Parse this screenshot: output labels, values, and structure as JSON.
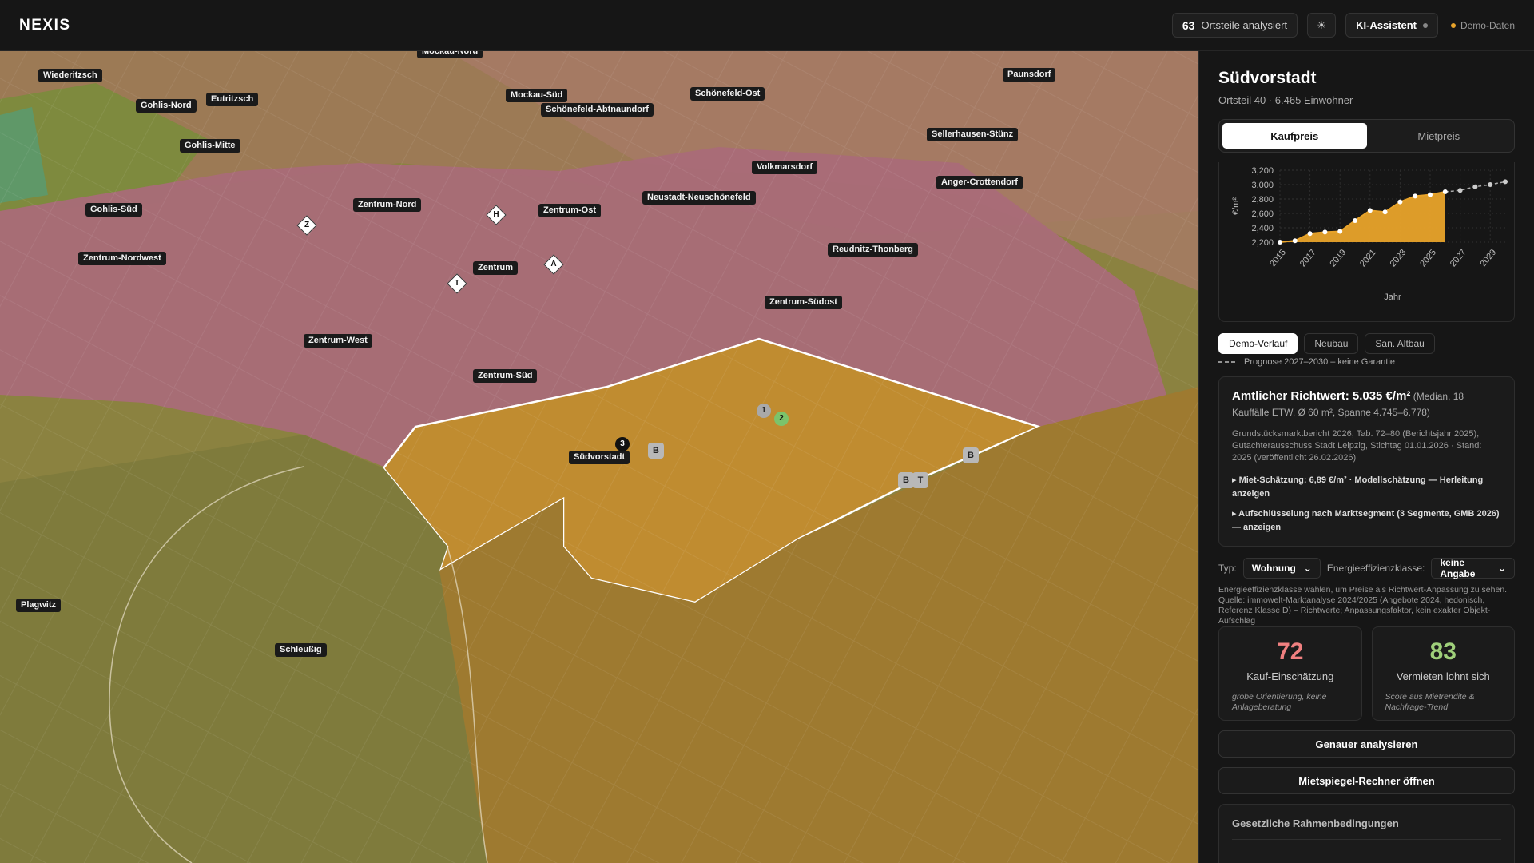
{
  "app": {
    "brand": "NEXIS"
  },
  "topbar": {
    "count": "63",
    "count_label": "Ortsteile analysiert",
    "theme_icon": "☀",
    "assistant_label": "KI-Assistent",
    "demo_label": "Demo-Daten",
    "assistant_dot_color": "#888888",
    "demo_dot_color": "#e8a32a"
  },
  "map": {
    "labels": [
      "Wiederitzsch",
      "Gohlis-Nord",
      "Eutritzsch",
      "Mockau-Nord",
      "Mockau-Süd",
      "Schönefeld-Abtnaundorf",
      "Schönefeld-Ost",
      "Paunsdorf",
      "Sellerhausen-Stünz",
      "Gohlis-Mitte",
      "Volkmarsdorf",
      "Anger-Crottendorf",
      "Gohlis-Süd",
      "Zentrum-Nord",
      "Zentrum-Ost",
      "Neustadt-Neuschönefeld",
      "Zentrum-Nordwest",
      "Reudnitz-Thonberg",
      "Zentrum",
      "Zentrum-Südost",
      "Zentrum-West",
      "Zentrum-Süd",
      "Südvorstadt",
      "Plagwitz",
      "Schleußig"
    ],
    "pois": [
      "Z",
      "H",
      "A",
      "T"
    ],
    "markers": [
      "B",
      "B",
      "B",
      "T",
      "1",
      "2",
      "3"
    ]
  },
  "panel": {
    "title": "Südvorstadt",
    "subtitle": "Ortsteil 40 · 6.465 Einwohner",
    "tabs": [
      "Kaufpreis",
      "Mietpreis"
    ],
    "series_chips": [
      "Demo-Verlauf",
      "Neubau",
      "San. Altbau"
    ],
    "forecast_note": "Prognose 2027–2030 – keine Garantie",
    "info": {
      "title": "Amtlicher Richtwert: 5.035 €/m²",
      "title_small": " (Median, 18 Kauffälle ETW, Ø 60 m², Spanne 4.745–6.778)",
      "source": "Grundstücksmarktbericht 2026, Tab. 72–80 (Berichtsjahr 2025), Gutachterausschuss Stadt Leipzig, Stichtag 01.01.2026 · Stand: 2025 (veröffentlicht 26.02.2026)",
      "link1": "▸ Miet-Schätzung: 6,89 €/m² · Modellschätzung — Herleitung anzeigen",
      "link2": "▸ Aufschlüsselung nach Marktsegment (3 Segmente, GMB 2026) — anzeigen"
    },
    "filters": {
      "type_label": "Typ:",
      "type_value": "Wohnung",
      "energy_label": "Energieeffizienzklasse:",
      "energy_value": "keine Angabe"
    },
    "hint": "Energieeffizienzklasse wählen, um Preise als Richtwert-Anpassung zu sehen. Quelle: immowelt-Marktanalyse 2024/2025 (Angebote 2024, hedonisch, Referenz Klasse D) – Richtwerte; Anpassungsfaktor, kein exakter Objekt-Aufschlag",
    "scores": [
      {
        "value": "72",
        "caption": "Kauf-Einschätzung",
        "note": "grobe Orientierung, keine Anlageberatung",
        "color": "#f08080"
      },
      {
        "value": "83",
        "caption": "Vermieten lohnt sich",
        "note": "Score aus Mietrendite & Nachfrage-Trend",
        "color": "#9fd07a"
      }
    ],
    "btn_analyze": "Genauer analysieren",
    "btn_mietspiegel": "Mietspiegel-Rechner öffnen",
    "legal_title": "Gesetzliche Rahmenbedingungen"
  },
  "chart_data": {
    "type": "area",
    "xlabel": "Jahr",
    "ylabel": "€/m²",
    "ylim": [
      2200,
      3200
    ],
    "yticks": [
      2200,
      2400,
      2600,
      2800,
      3000,
      3200
    ],
    "xticks": [
      "2015",
      "2017",
      "2019",
      "2021",
      "2023",
      "2025",
      "2027",
      "2029"
    ],
    "x": [
      2015,
      2016,
      2017,
      2018,
      2019,
      2020,
      2021,
      2022,
      2023,
      2024,
      2025,
      2026,
      2027,
      2028,
      2029,
      2030
    ],
    "series": [
      {
        "values": [
          2200,
          2220,
          2320,
          2340,
          2350,
          2500,
          2640,
          2620,
          2760,
          2840,
          2860,
          2900,
          2920,
          2970,
          3000,
          3040
        ]
      }
    ],
    "forecast_from": 2027,
    "fill_color": "#e8a32a"
  }
}
